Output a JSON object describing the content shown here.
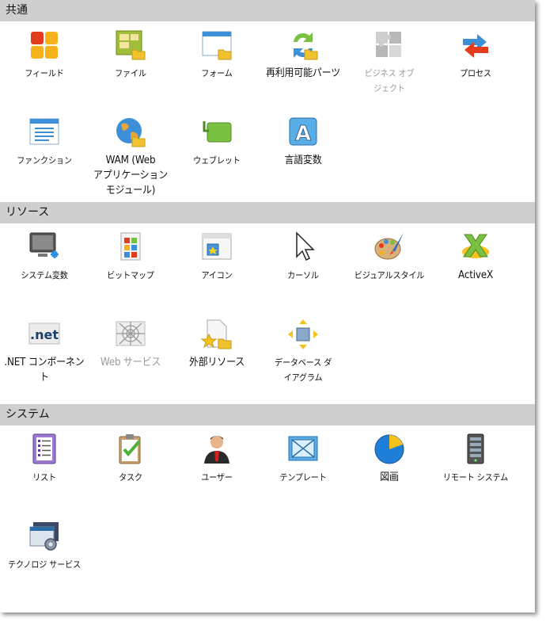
{
  "sections": [
    {
      "title": "共通",
      "items": [
        {
          "label": "フィールド",
          "icon": "fields-icon"
        },
        {
          "label": "ファイル",
          "icon": "file-icon"
        },
        {
          "label": "フォーム",
          "icon": "form-icon"
        },
        {
          "label": "再利用可能パーツ",
          "icon": "reusable-parts-icon"
        },
        {
          "label": "ビジネス オブ\nジェクト",
          "icon": "business-object-icon",
          "disabled": true
        },
        {
          "label": "プロセス",
          "icon": "process-icon"
        },
        {
          "label": "ファンクション",
          "icon": "function-icon"
        },
        {
          "label": "WAM (Web\nアプリケーション\nモジュール)",
          "icon": "wam-icon"
        },
        {
          "label": "ウェブレット",
          "icon": "weblet-icon"
        },
        {
          "label": "言語変数",
          "icon": "language-variable-icon"
        }
      ]
    },
    {
      "title": "リソース",
      "items": [
        {
          "label": "システム変数",
          "icon": "system-variable-icon"
        },
        {
          "label": "ビットマップ",
          "icon": "bitmap-icon"
        },
        {
          "label": "アイコン",
          "icon": "icon-resource-icon"
        },
        {
          "label": "カーソル",
          "icon": "cursor-icon"
        },
        {
          "label": "ビジュアルスタイル",
          "icon": "visual-style-icon"
        },
        {
          "label": "ActiveX",
          "icon": "activex-icon"
        },
        {
          "label": ".NET コンポーネント",
          "icon": "dotnet-icon"
        },
        {
          "label": "Web サービス",
          "icon": "web-service-icon",
          "disabled": true
        },
        {
          "label": "外部リソース",
          "icon": "external-resource-icon"
        },
        {
          "label": "データベース ダ\nイアグラム",
          "icon": "database-diagram-icon"
        }
      ]
    },
    {
      "title": "システム",
      "items": [
        {
          "label": "リスト",
          "icon": "list-icon"
        },
        {
          "label": "タスク",
          "icon": "task-icon"
        },
        {
          "label": "ユーザー",
          "icon": "user-icon"
        },
        {
          "label": "テンプレート",
          "icon": "template-icon"
        },
        {
          "label": "図画",
          "icon": "drawing-icon"
        },
        {
          "label": "リモート システム",
          "icon": "remote-system-icon"
        },
        {
          "label": "テクノロジ サービス",
          "icon": "technology-service-icon"
        }
      ]
    }
  ]
}
